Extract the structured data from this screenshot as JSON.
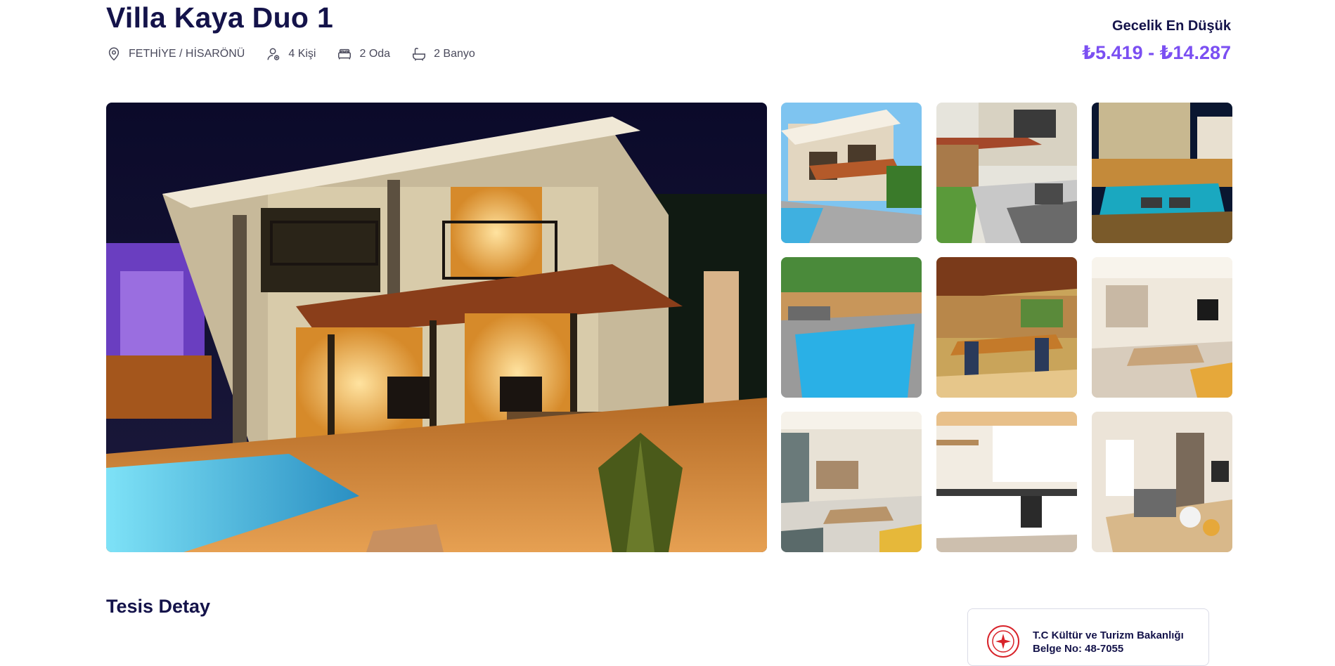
{
  "listing": {
    "title": "Villa Kaya Duo 1",
    "location": "FETHİYE / HİSARÖNÜ",
    "guests": "4 Kişi",
    "rooms": "2 Oda",
    "bathrooms": "2 Banyo"
  },
  "pricing": {
    "label": "Gecelik En Düşük",
    "range": "₺5.419 - ₺14.287",
    "accent_color": "#7b4ff2"
  },
  "gallery": {
    "main": "villa-exterior-night",
    "thumbnails": [
      "villa-exterior-day",
      "villa-terrace-loungers",
      "pool-night-lights",
      "pool-garden",
      "pergola-dining",
      "living-room",
      "living-room-dining",
      "kitchen",
      "dining-table"
    ]
  },
  "details": {
    "section_title": "Tesis Detay",
    "license_line1": "T.C Kültür ve Turizm Bakanlığı",
    "license_line2": "Belge No: 48-7055"
  },
  "icons": {
    "location": "map-pin-icon",
    "guests": "user-icon",
    "rooms": "bed-icon",
    "bathrooms": "bathtub-icon"
  },
  "colors": {
    "heading": "#14134a",
    "card_border": "#dadbe6"
  }
}
